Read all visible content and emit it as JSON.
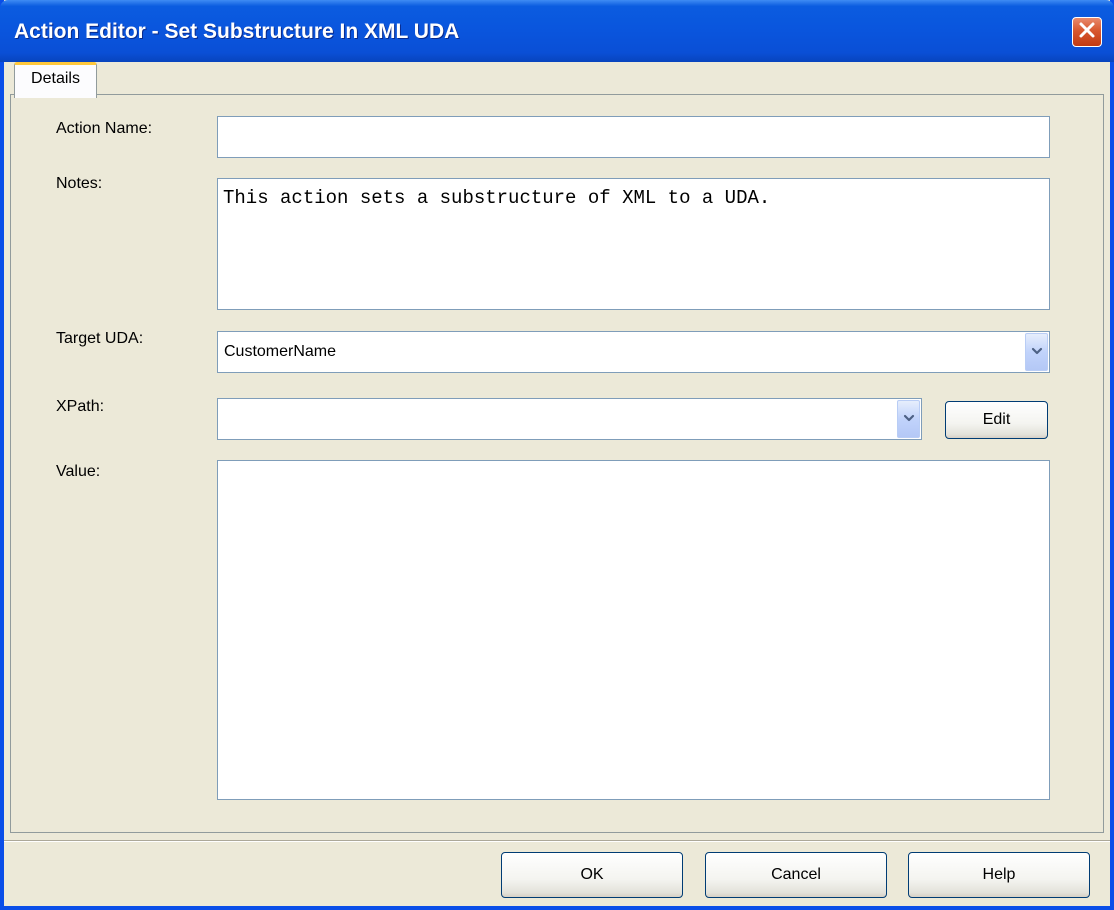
{
  "window": {
    "title": "Action Editor - Set Substructure In XML UDA"
  },
  "tabs": [
    {
      "label": "Details",
      "selected": true
    }
  ],
  "form": {
    "action_name": {
      "label": "Action Name:",
      "value": ""
    },
    "notes": {
      "label": "Notes:",
      "value": "This action sets a substructure of XML to a UDA."
    },
    "target_uda": {
      "label": "Target UDA:",
      "value": "CustomerName"
    },
    "xpath": {
      "label": "XPath:",
      "value": "",
      "edit_label": "Edit"
    },
    "value": {
      "label": "Value:",
      "value": ""
    }
  },
  "footer": {
    "ok_label": "OK",
    "cancel_label": "Cancel",
    "help_label": "Help"
  },
  "icons": {
    "close": "close-icon",
    "dropdown": "chevron-down-icon"
  },
  "colors": {
    "titlebar": "#0a55dd",
    "dialog_bg": "#ece9d8",
    "field_border": "#7f9db9",
    "tab_highlight": "#ffc83c",
    "close_button": "#d8582f"
  }
}
